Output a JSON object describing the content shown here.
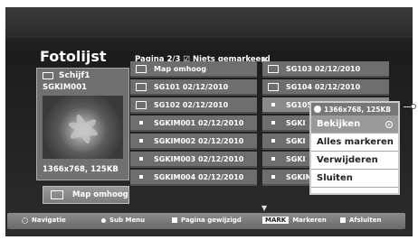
{
  "title": "Fotolijst",
  "page_info": "Pagina 2/3 ☑ Niets gemarkeerd",
  "preview": {
    "drive": "Schijf1",
    "device": "SGKIM001",
    "resolution": "1366x768, 125KB"
  },
  "map_button": "Map omhoog",
  "grid": {
    "col1": [
      "Map omhoog",
      "SG101 02/12/2010",
      "SG102 02/12/2010",
      "SGKIM001 02/12/2010",
      "SGKIM002 02/12/2010",
      "SGKIM003 02/12/2010",
      "SGKIM004 02/12/2010"
    ],
    "col2": [
      "SG103 02/12/2010",
      "SG104 02/12/2010",
      "SG105",
      "SGKI",
      "SGKI",
      "SGKI",
      "SGKIM008 02/12/2010"
    ]
  },
  "popup": {
    "header": "1366x768, 125KB",
    "items": [
      "Bekijken",
      "Alles markeren",
      "Verwijderen",
      "Sluiten"
    ]
  },
  "bottom": {
    "nav": "Navigatie",
    "sub": "Sub Menu",
    "page": "Pagina gewijzigd",
    "mark_key": "MARK",
    "mark": "Markeren",
    "exit": "Afsluiten"
  }
}
